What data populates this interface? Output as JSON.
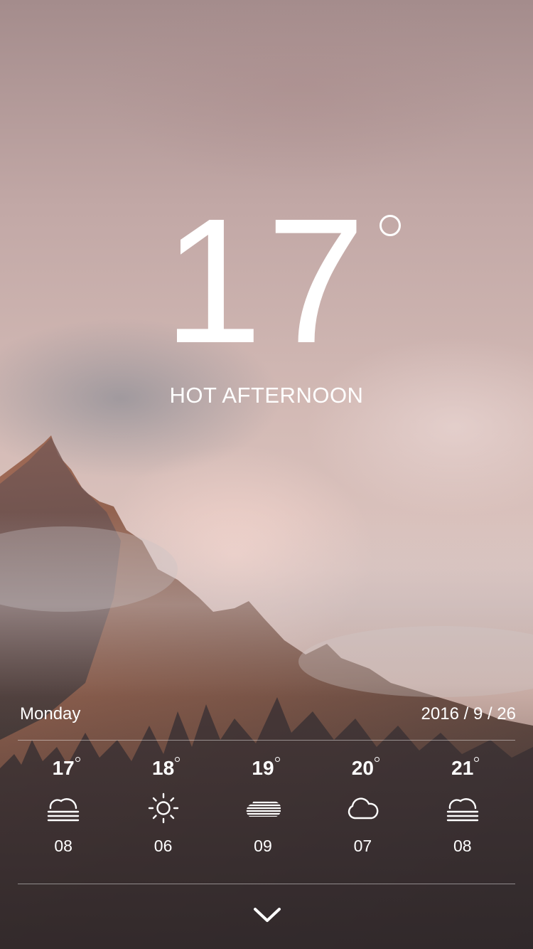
{
  "current": {
    "temperature": "17",
    "condition": "HOT AFTERNOON"
  },
  "date_bar": {
    "day": "Monday",
    "date": "2016 / 9 / 26"
  },
  "forecast": [
    {
      "temp": "17",
      "icon": "fog-icon",
      "value": "08"
    },
    {
      "temp": "18",
      "icon": "sun-icon",
      "value": "06"
    },
    {
      "temp": "19",
      "icon": "haze-icon",
      "value": "09"
    },
    {
      "temp": "20",
      "icon": "cloud-icon",
      "value": "07"
    },
    {
      "temp": "21",
      "icon": "fog-icon",
      "value": "08"
    }
  ],
  "expand_icon": "chevron-down-icon",
  "colors": {
    "text": "#ffffff",
    "divider": "rgba(255,255,255,0.45)"
  }
}
